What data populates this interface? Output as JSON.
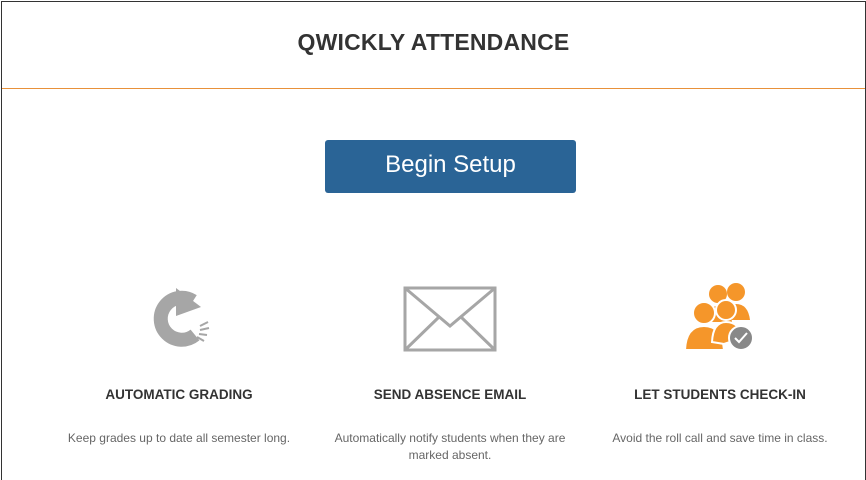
{
  "header": {
    "title": "QWICKLY ATTENDANCE"
  },
  "setup": {
    "label": "Begin Setup"
  },
  "features": [
    {
      "icon": "refresh-arrow-icon",
      "title": "AUTOMATIC GRADING",
      "description": "Keep grades up to date all semester long."
    },
    {
      "icon": "envelope-icon",
      "title": "SEND ABSENCE EMAIL",
      "description": "Automatically notify students when they are marked absent."
    },
    {
      "icon": "students-check-icon",
      "title": "LET STUDENTS CHECK-IN",
      "description": "Avoid the roll call and save time in class."
    }
  ],
  "colors": {
    "accent": "#e8913a",
    "button": "#2a6496",
    "icon_gray": "#a6a6a6",
    "icon_orange": "#f5962a",
    "border": "#333333"
  }
}
